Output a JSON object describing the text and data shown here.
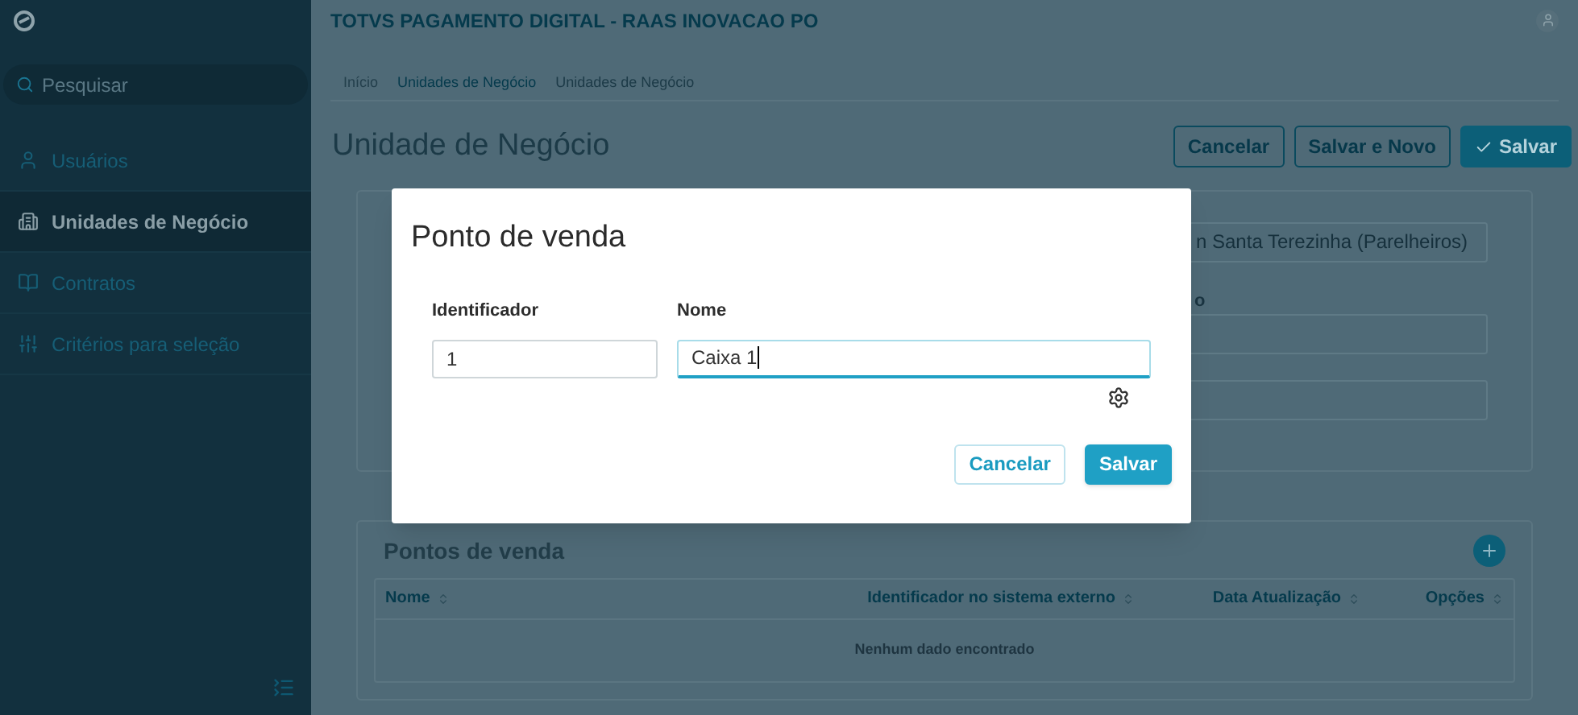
{
  "sidebar": {
    "search": {
      "placeholder": "Pesquisar"
    },
    "items": [
      {
        "label": "Usuários",
        "selected": false
      },
      {
        "label": "Unidades de Negócio",
        "selected": true
      },
      {
        "label": "Contratos",
        "selected": false
      },
      {
        "label": "Critérios para seleção",
        "selected": false
      }
    ]
  },
  "header": {
    "title": "TOTVS PAGAMENTO DIGITAL - RAAS INOVACAO PO"
  },
  "breadcrumb": [
    {
      "label": "Início"
    },
    {
      "label": "Unidades de Negócio"
    },
    {
      "label": "Unidades de Negócio"
    }
  ],
  "page": {
    "title": "Unidade de Negócio",
    "actions": [
      {
        "label": "Cancelar",
        "kind": "secondary"
      },
      {
        "label": "Salvar e Novo",
        "kind": "secondary"
      },
      {
        "label": "Salvar",
        "kind": "primary"
      }
    ]
  },
  "form": {
    "fields": [
      {
        "value": "n Santa Terezinha (Parelheiros)"
      },
      {
        "label": "o"
      }
    ]
  },
  "points_of_sale": {
    "title": "Pontos de venda",
    "columns": [
      "Nome",
      "Identificador no sistema externo",
      "Data Atualização",
      "Opções"
    ],
    "empty_message": "Nenhum dado encontrado"
  },
  "dialog": {
    "title": "Ponto de venda",
    "fields": [
      {
        "label": "Identificador",
        "value": "1",
        "focused": false
      },
      {
        "label": "Nome",
        "value": "Caixa 1",
        "focused": true
      }
    ],
    "actions": [
      {
        "label": "Cancelar",
        "kind": "secondary"
      },
      {
        "label": "Salvar",
        "kind": "primary"
      }
    ]
  }
}
